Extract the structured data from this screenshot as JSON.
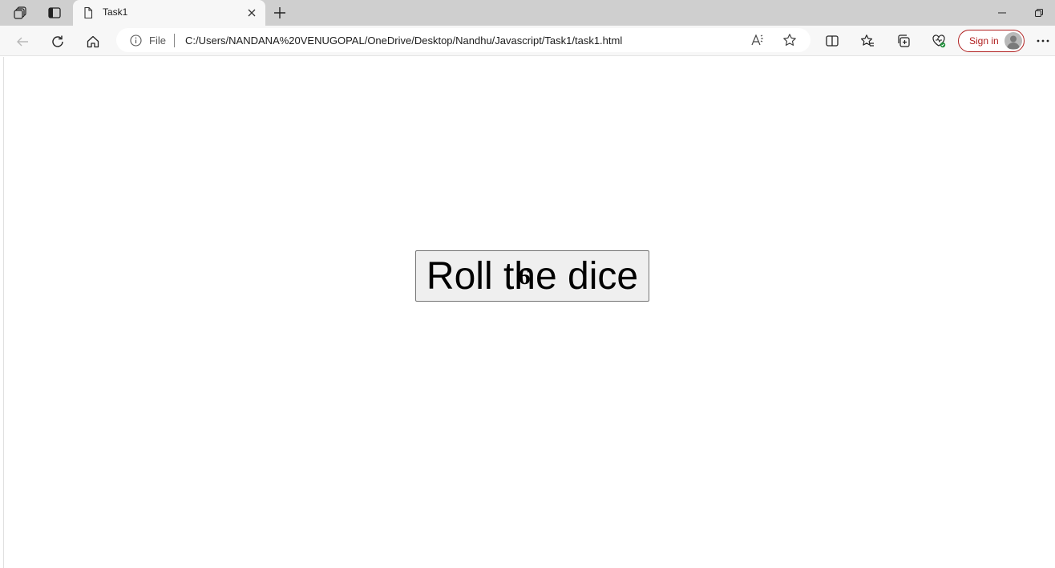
{
  "browser": {
    "tab": {
      "title": "Task1"
    },
    "address_bar": {
      "scheme_label": "File",
      "url": "C:/Users/NANDANA%20VENUGOPAL/OneDrive/Desktop/Nandhu/Javascript/Task1/task1.html"
    },
    "sign_in_label": "Sign in",
    "icons": {
      "tab_bar": [
        "workspaces-icon",
        "vertical-tabs-icon",
        "page-icon",
        "close-icon",
        "new-tab-icon",
        "minimize-icon",
        "restore-icon"
      ],
      "toolbar": [
        "back-icon",
        "refresh-icon",
        "home-icon",
        "info-icon",
        "read-aloud-icon",
        "favorite-star-icon",
        "split-screen-icon",
        "favorites-icon",
        "collections-icon",
        "browser-essentials-icon",
        "avatar",
        "more-icon"
      ]
    }
  },
  "page": {
    "button_label": "Roll the dice",
    "dice_value": "6"
  }
}
